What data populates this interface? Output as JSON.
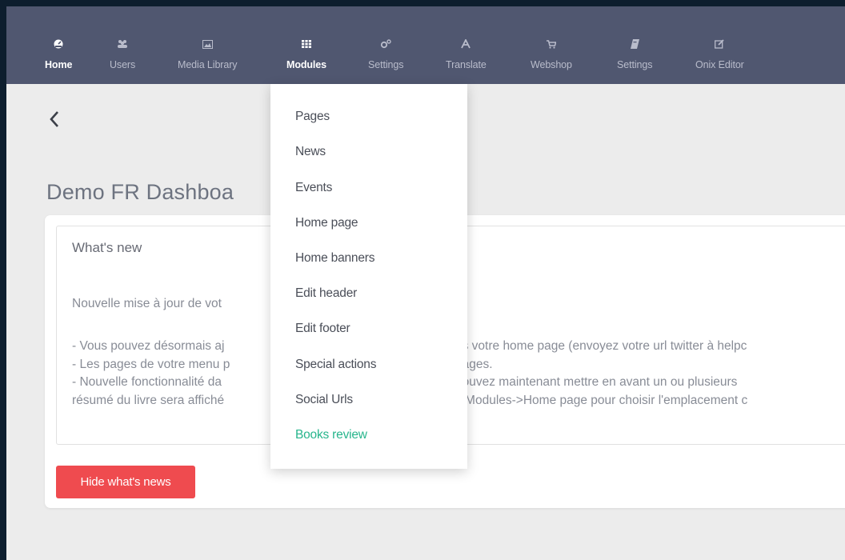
{
  "nav": {
    "items": [
      {
        "label": "Home",
        "icon": "dashboard-icon"
      },
      {
        "label": "Users",
        "icon": "users-icon"
      },
      {
        "label": "Media Library",
        "icon": "image-icon"
      },
      {
        "label": "Modules",
        "icon": "grid-icon"
      },
      {
        "label": "Settings",
        "icon": "gears-icon"
      },
      {
        "label": "Translate",
        "icon": "font-icon"
      },
      {
        "label": "Webshop",
        "icon": "cart-icon"
      },
      {
        "label": "Settings",
        "icon": "book-icon"
      },
      {
        "label": "Onix Editor",
        "icon": "edit-icon"
      }
    ],
    "active_items": [
      "Home",
      "Modules"
    ]
  },
  "page": {
    "back_icon": "chevron-left-icon",
    "title": "Demo FR Dashboa"
  },
  "whats_new": {
    "heading": "What's new",
    "intro": "Nouvelle mise à jour de vot",
    "lines": [
      {
        "left": "- Vous pouvez désormais aj",
        "right": "ns votre home page (envoyez votre url twitter à helpc"
      },
      {
        "left": "- Les pages de votre menu p",
        "right": "pages."
      },
      {
        "left": "- Nouvelle fonctionnalité da",
        "right": "pouvez maintenant mettre en avant un ou plusieurs"
      },
      {
        "left": "résumé du livre sera affiché",
        "right": "s Modules->Home page pour choisir l'emplacement c"
      }
    ],
    "hide_button": "Hide what's news"
  },
  "modules_menu": {
    "items": [
      "Pages",
      "News",
      "Events",
      "Home page",
      "Home banners",
      "Edit header",
      "Edit footer",
      "Special actions",
      "Social Urls",
      "Books review"
    ],
    "highlighted": "Books review"
  },
  "colors": {
    "nav_bg": "#505770",
    "page_bg": "#ececec",
    "accent_green": "#27b58c",
    "danger_red": "#ef4b4f",
    "outer_bg": "#0d1e2e"
  }
}
